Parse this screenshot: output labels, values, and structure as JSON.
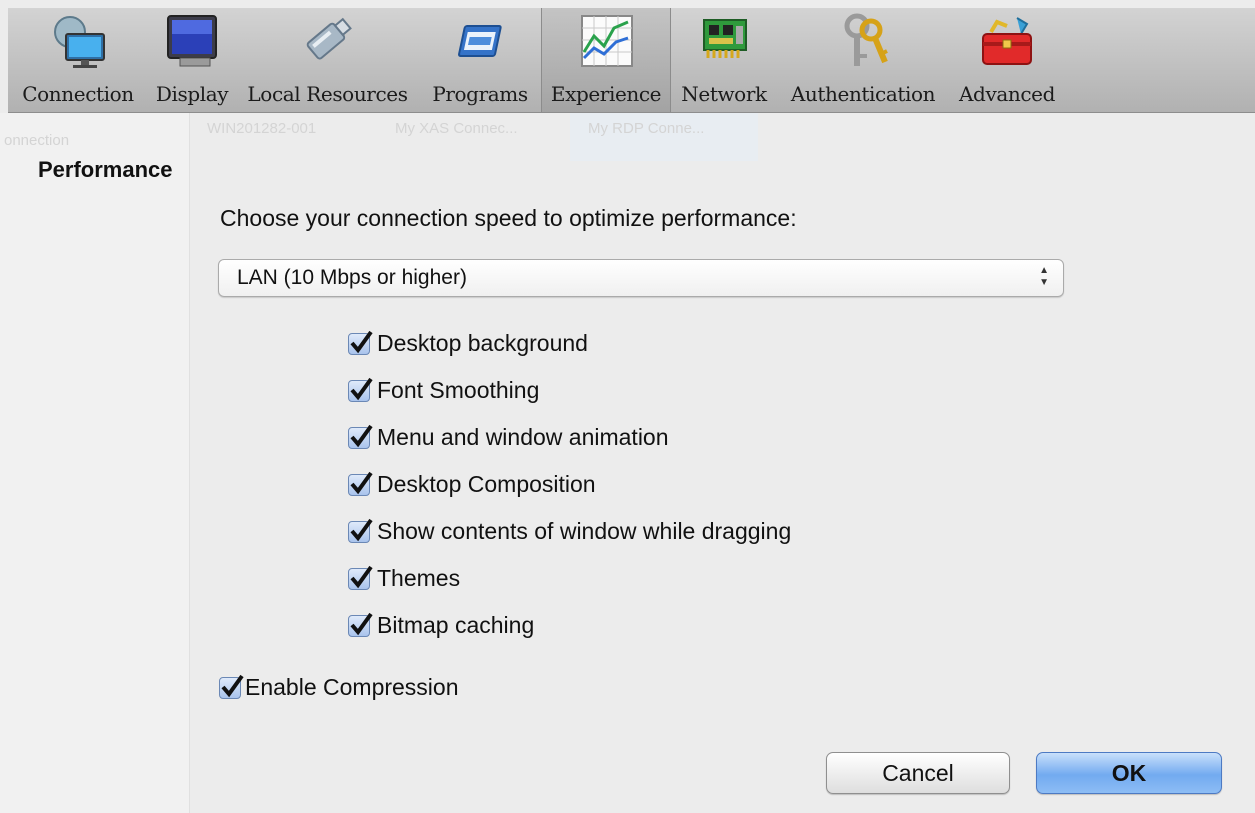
{
  "toolbar": {
    "items": [
      {
        "label": "Connection",
        "icon": "monitor-globe-icon"
      },
      {
        "label": "Display",
        "icon": "display-icon"
      },
      {
        "label": "Local Resources",
        "icon": "usb-drive-icon"
      },
      {
        "label": "Programs",
        "icon": "program-window-icon"
      },
      {
        "label": "Experience",
        "icon": "performance-graph-icon",
        "active": true
      },
      {
        "label": "Network",
        "icon": "network-card-icon"
      },
      {
        "label": "Authentication",
        "icon": "keys-icon"
      },
      {
        "label": "Advanced",
        "icon": "toolbox-icon"
      }
    ]
  },
  "background": {
    "left_label": "onnection",
    "tabs": [
      "WIN201282-001",
      "My XAS Connec...",
      "My RDP Conne..."
    ]
  },
  "performance": {
    "title": "Performance",
    "prompt": "Choose your connection speed to optimize performance:",
    "speed_select": {
      "value": "LAN (10 Mbps or higher)"
    },
    "options": [
      {
        "label": "Desktop background",
        "checked": true
      },
      {
        "label": "Font Smoothing",
        "checked": true
      },
      {
        "label": "Menu and window animation",
        "checked": true
      },
      {
        "label": "Desktop Composition",
        "checked": true
      },
      {
        "label": "Show contents of window while dragging",
        "checked": true
      },
      {
        "label": "Themes",
        "checked": true
      },
      {
        "label": "Bitmap caching",
        "checked": true
      }
    ],
    "compression": {
      "label": "Enable Compression",
      "checked": true
    }
  },
  "buttons": {
    "cancel": "Cancel",
    "ok": "OK"
  },
  "colors": {
    "accent": "#72aaf0",
    "checkbox": "#a9c3ec",
    "toolbar": "#bcbcbc"
  }
}
